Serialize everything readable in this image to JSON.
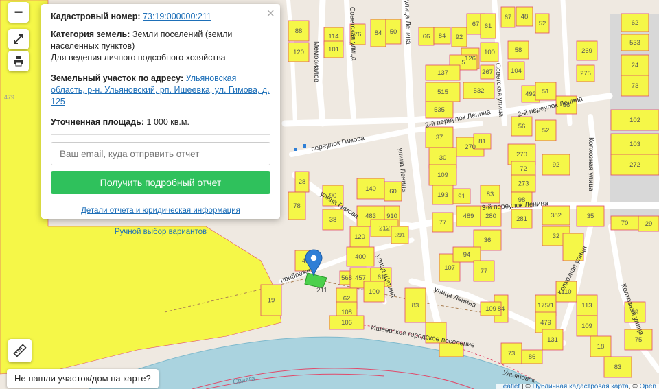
{
  "map": {
    "street_labels": {
      "memorialov": "Мемориалов",
      "sovetskaya_upper": "Советская улица",
      "lenina_upper": "улица Ленина",
      "sovetskaya": "Советская улица",
      "lane_lenina_2_left": "2-й переулок Ленина",
      "lane_lenina_2_right": "2-й переулок Ленина",
      "gimova_lane": "переулок Гимова",
      "gimova_street": "улица Гимова",
      "lenina_mid": "улица Ленина",
      "lane_lenina_3": "3-й переулок Ленина",
      "kolkhoznaya_right": "Колхозная улица",
      "kolkhoznaya_mid": "Колхозная улица",
      "kolkhoznaya_bottom": "Колхозная улица",
      "shchetin": "улица Щетина",
      "pribrezhnaya": "прибрежн.",
      "lenina_lower": "улица Ленина",
      "isheevka_boundary": "Ишеевское городское поселение",
      "ulyanovsk_boundary": "Ульяновск",
      "sviyaga": "Свияга"
    },
    "parcel_numbers": [
      "88",
      "120",
      "114",
      "101",
      "76",
      "84",
      "50",
      "66",
      "84",
      "92",
      "67",
      "61",
      "126",
      "100",
      "67",
      "48",
      "52",
      "62",
      "533",
      "5",
      "267",
      "137",
      "58",
      "104",
      "515",
      "535",
      "532",
      "492",
      "51",
      "36",
      "269",
      "275",
      "24",
      "73",
      "37",
      "30",
      "270",
      "81",
      "56",
      "52",
      "270",
      "72",
      "92",
      "102",
      "103",
      "272",
      "273",
      "109",
      "193",
      "91",
      "83",
      "98",
      "77",
      "489",
      "280",
      "281",
      "382",
      "32",
      "35",
      "36",
      "70",
      "29",
      "28",
      "78",
      "90",
      "38",
      "120",
      "140",
      "60",
      "483",
      "910",
      "212",
      "391",
      "400",
      "45",
      "568",
      "457",
      "61",
      "100",
      "62",
      "108",
      "106",
      "107",
      "94",
      "77",
      "84",
      "109",
      "175/1",
      "479",
      "131",
      "110",
      "113",
      "109",
      "18",
      "89",
      "75",
      "73",
      "86",
      "83",
      "19",
      "83"
    ],
    "selected_parcel": "211",
    "left_zone_label": "479"
  },
  "controls": {
    "zoom_out": "−",
    "fullscreen_icon": "expand-icon",
    "print_icon": "print-icon",
    "ruler_icon": "ruler-icon"
  },
  "popup": {
    "cadastral_label": "Кадастровый номер:",
    "cadastral_value": "73:19:000000:211",
    "category_label": "Категория земель:",
    "category_value": "Земли поселений (земли населенных пунктов)",
    "usage_value": "Для ведения личного подсобного хозяйства",
    "address_label": "Земельный участок по адресу:",
    "address_value": "Ульяновская область, р-н. Ульяновский, рп. Ишеевка, ул. Гимова, д. 125",
    "area_label": "Уточненная площадь:",
    "area_value": "1 000 кв.м.",
    "email_placeholder": "Ваш email, куда отправить отчет",
    "submit_label": "Получить подробный отчет",
    "details_link": "Детали отчета и юридическая информация",
    "manual_link": "Ручной выбор вариантов",
    "close": "×"
  },
  "not_found": "Не нашли участок/дом на карте?",
  "attribution": {
    "leaflet": "Leaflet",
    "separator": " | © ",
    "public_map": "Публичная кадастровая карта",
    "osm_prefix": ", © ",
    "osm": "Open"
  },
  "colors": {
    "parcel_fill": "#f5f748",
    "parcel_stroke": "#e04a6a",
    "selected_fill": "#4cd04c",
    "marker": "#2f7fd6",
    "river": "#aad3df",
    "water_strip": "#ddd",
    "button_green": "#2fc15c",
    "gray_block": "#d8d8d8"
  }
}
